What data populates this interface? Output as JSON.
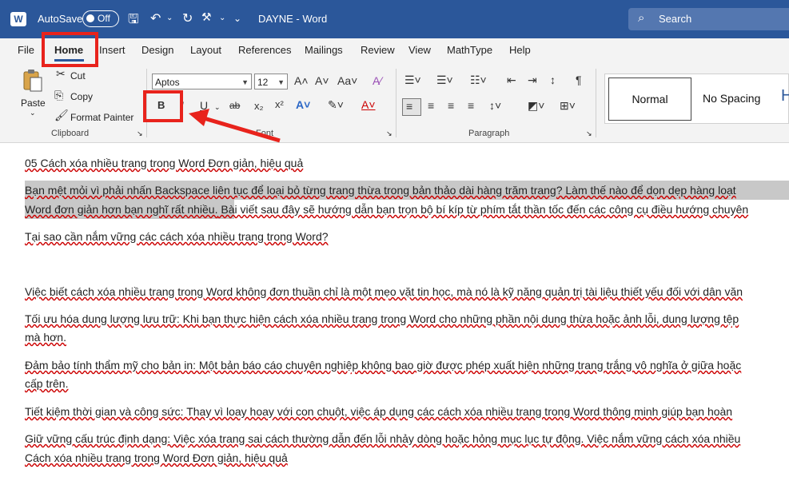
{
  "titlebar": {
    "autosave_label": "AutoSave",
    "autosave_state": "Off",
    "document_title": "DAYNE  -  Word",
    "search_placeholder": "Search",
    "app_color": "#2b579a"
  },
  "menu": {
    "items": [
      "File",
      "Home",
      "Insert",
      "Design",
      "Layout",
      "References",
      "Mailings",
      "Review",
      "View",
      "MathType",
      "Help"
    ],
    "active": "Home"
  },
  "clipboard": {
    "paste": "Paste",
    "cut": "Cut",
    "copy": "Copy",
    "format_painter": "Format Painter",
    "label": "Clipboard"
  },
  "font": {
    "name": "Aptos",
    "size": "12",
    "bold": "B",
    "italic": "I",
    "underline": "U",
    "strike": "ab",
    "label": "Font"
  },
  "paragraph": {
    "label": "Paragraph"
  },
  "styles": {
    "normal": "Normal",
    "no_spacing": "No Spacing",
    "heading_partial": "H"
  },
  "document": {
    "line1": "05 Cách xóa nhiều trang trong Word Đơn giản, hiệu quả",
    "para1_line1": "Bạn mệt mỏi vì phải nhấn Backspace liên tục để loại bỏ từng trang thừa trong bản thảo dài hàng trăm trang? Làm thế nào để dọn dẹp hàng loạt",
    "para1_line2a": "Word đơn giản hơn bạn nghĩ rất nhiều.",
    "para1_line2b": " Bài viết sau đây sẽ hướng dẫn bạn trọn bộ bí kíp từ phím tắt thần tốc đến các công cụ điều hướng chuyên",
    "line3": "Tại sao cần nắm vững các cách xóa nhiều trang trong Word?",
    "line4": "Việc biết cách xóa nhiều trang trong Word không đơn thuần chỉ là một mẹo vặt tin học, mà nó là kỹ năng quản trị tài liệu thiết yếu đối với dân văn",
    "line5a": "Tối ưu hóa dung lượng lưu trữ: Khi bạn thực hiện cách xóa nhiều trang trong Word cho những phần nội dung thừa hoặc ảnh lỗi, dung lượng tệp",
    "line5b": "mà hơn.",
    "line6a": "Đảm bảo tính thẩm mỹ cho bản in: Một bản báo cáo chuyên nghiệp không bao giờ được phép xuất hiện những trang trắng vô nghĩa ở giữa hoặc",
    "line6b": "cấp trên.",
    "line7": "Tiết kiệm thời gian và công sức: Thay vì loay hoay với con chuột, việc áp dụng các cách xóa nhiều trang trong Word thông minh giúp bạn hoàn",
    "line8": "Giữ vững cấu trúc định dạng: Việc xóa trang sai cách thường dẫn đến lỗi nhảy dòng hoặc hỏng mục lục tự động. Việc nắm vững cách xóa nhiều",
    "line9": "Cách xóa nhiều trang trong Word Đơn giản, hiệu quả"
  },
  "annotation_color": "#e8231c"
}
